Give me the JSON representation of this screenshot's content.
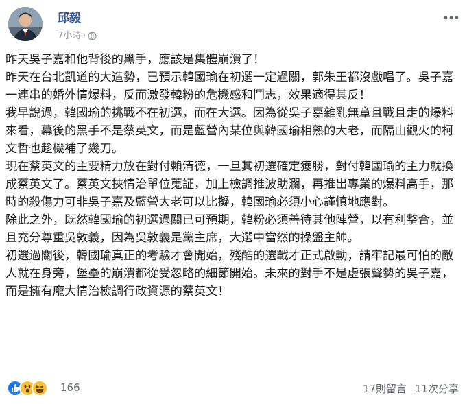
{
  "author": {
    "name": "邱毅",
    "time": "7小時",
    "separator": "·",
    "privacy_icon": "globe-icon",
    "more_icon": "more-options-icon"
  },
  "post": {
    "paragraphs": [
      "昨天吳子嘉和他背後的黑手，應該是集體崩潰了！",
      "昨天在台北凱道的大造勢，已預示韓國瑜在初選一定過關，郭朱王都沒戲唱了。吳子嘉一連串的婚外情爆料，反而激發韓粉的危機感和鬥志，效果適得其反！",
      "我早說過，韓國瑜的挑戰不在初選，而在大選。因為從吳子嘉雜亂無章且戰且走的爆料來看，幕後的黑手不是蔡英文，而是藍營內某位與韓國瑜相熟的大老，而隔山觀火的柯文哲也趁機補了幾刀。",
      "現在蔡英文的主要精力放在對付賴清德，一旦其初選確定獲勝，對付韓國瑜的主力就換成蔡英文了。蔡英文挾情治單位蒐証，加上檢調推波助瀾，再推出專業的爆料高手，那時的殺傷力可非吳子嘉及藍營大老可以比擬，韓國瑜必須小心謹慎地應對。",
      "除此之外，既然韓國瑜的初選過關已可預期，韓粉必須善待其他陣營，以有利整合，並且充分尊重吳敦義，因為吳敦義是黨主席，大選中當然的操盤主帥。",
      "初選過關後，韓國瑜真正的考驗才會開始，殘酷的選戰才正式啟動，請牢記最可怕的敵人就在身旁，堡壘的崩潰都從受忽略的細節開始。未來的對手不是虛張聲勢的吳子嘉，而是擁有龐大情治檢調行政資源的蔡英文！"
    ]
  },
  "footer": {
    "reaction_icons": [
      "like-icon",
      "wow-icon",
      "haha-icon"
    ],
    "reaction_count": "166",
    "comments": "17則留言",
    "shares": "11次分享"
  },
  "colors": {
    "name": "#385898",
    "meta": "#90949c",
    "text": "#1c1e21",
    "like": "#1877f2",
    "emoji": "#f7c034"
  }
}
